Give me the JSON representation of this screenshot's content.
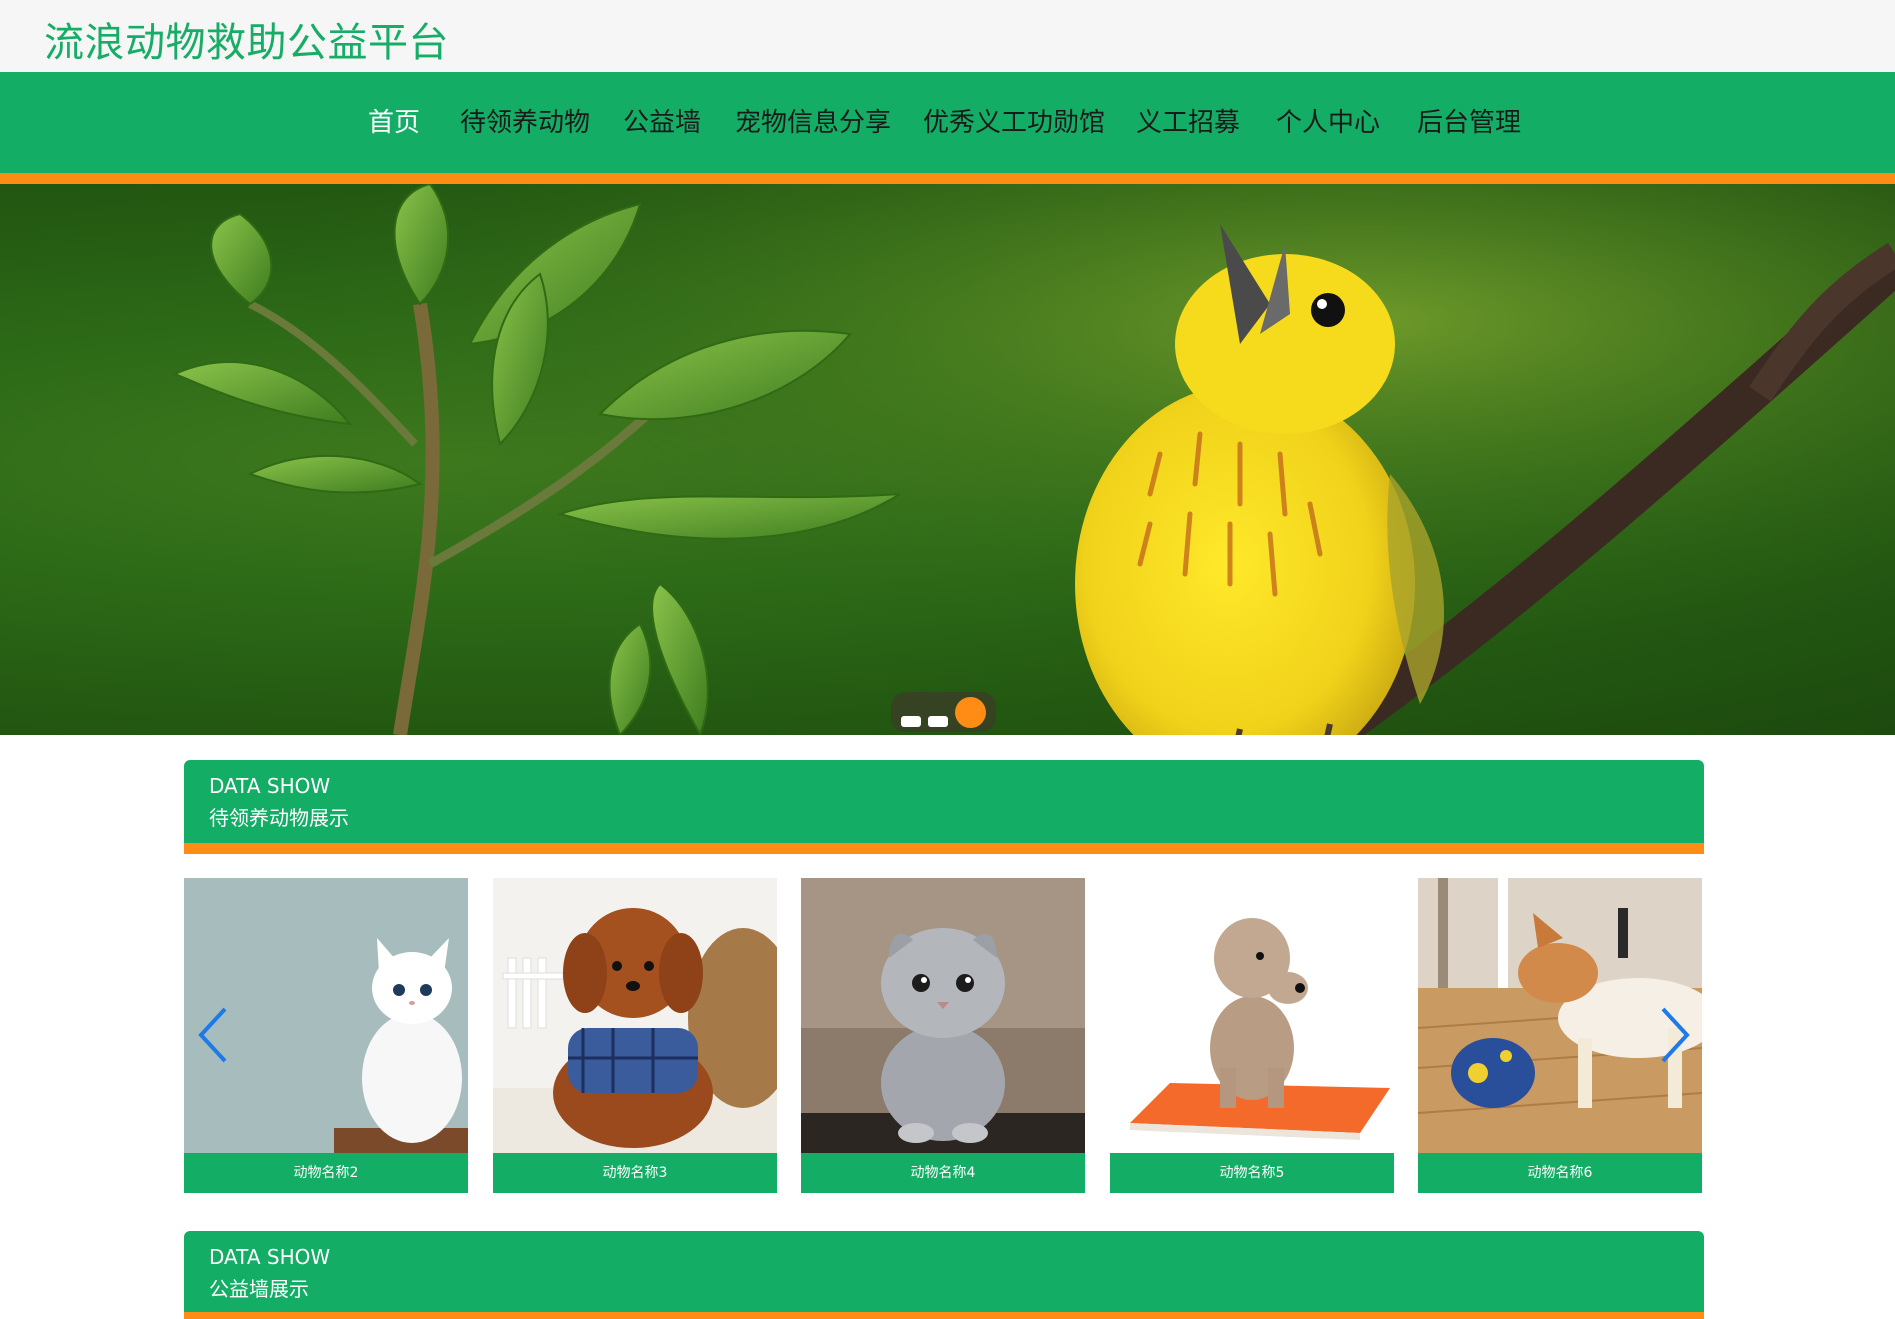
{
  "site": {
    "title": "流浪动物救助公益平台"
  },
  "nav": {
    "items": [
      {
        "label": "首页",
        "active": true
      },
      {
        "label": "待领养动物"
      },
      {
        "label": "公益墙"
      },
      {
        "label": "宠物信息分享"
      },
      {
        "label": "优秀义工功勋馆"
      },
      {
        "label": "义工招募"
      },
      {
        "label": "个人中心"
      },
      {
        "label": "后台管理"
      }
    ]
  },
  "banner": {
    "slide_count": 3,
    "active_slide": 3
  },
  "sections": [
    {
      "en": "DATA SHOW",
      "cn": "待领养动物展示"
    },
    {
      "en": "DATA SHOW",
      "cn": "公益墙展示"
    }
  ],
  "animals": [
    {
      "name": "动物名称2"
    },
    {
      "name": "动物名称3"
    },
    {
      "name": "动物名称4"
    },
    {
      "name": "动物名称5"
    },
    {
      "name": "动物名称6"
    }
  ],
  "colors": {
    "brand_green": "#14ad66",
    "accent_orange": "#ff8c14",
    "arrow_blue": "#1e7ae8"
  }
}
